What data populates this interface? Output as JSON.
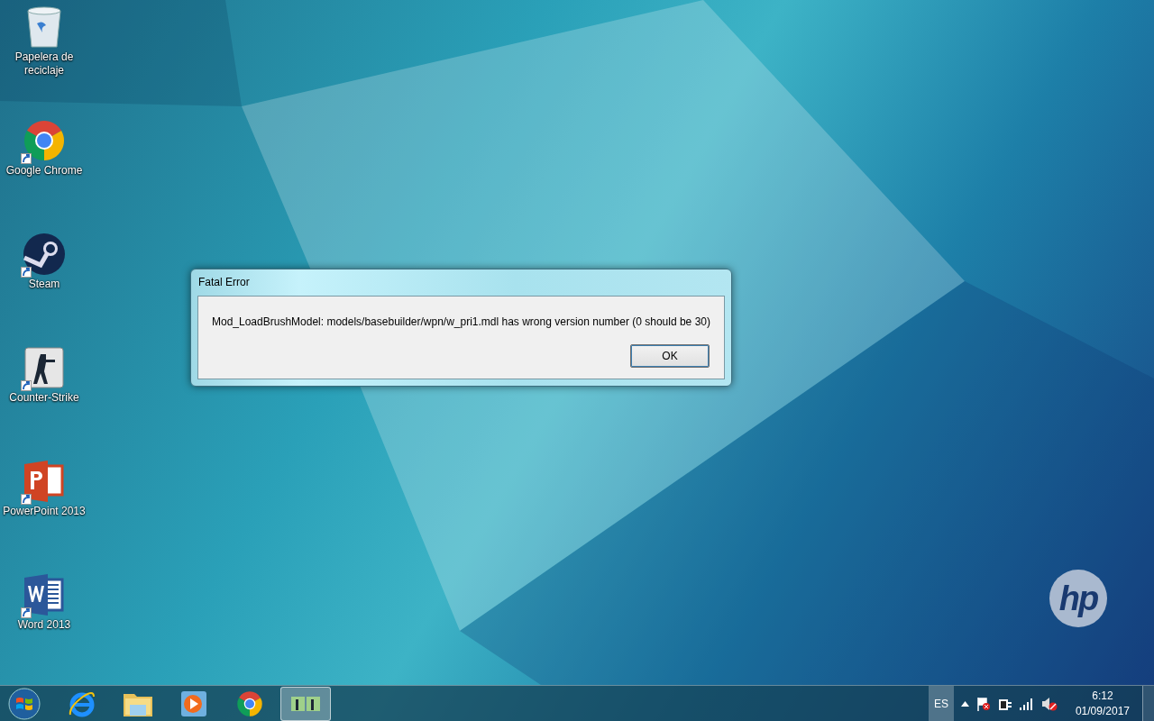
{
  "desktop_icons": [
    {
      "kind": "recycle-bin",
      "label": "Papelera de reciclaje",
      "shortcut": false
    },
    {
      "kind": "chrome",
      "label": "Google Chrome",
      "shortcut": true
    },
    {
      "kind": "steam",
      "label": "Steam",
      "shortcut": true
    },
    {
      "kind": "soldier",
      "label": "Counter-Strike",
      "shortcut": true
    },
    {
      "kind": "powerpoint",
      "label": "PowerPoint 2013",
      "shortcut": true
    },
    {
      "kind": "word",
      "label": "Word 2013",
      "shortcut": true
    }
  ],
  "dialog": {
    "title": "Fatal Error",
    "message": "Mod_LoadBrushModel: models/basebuilder/wpn/w_pri1.mdl has wrong version number (0 should be 30)",
    "buttons": [
      "OK"
    ]
  },
  "wallpaper_logo": "hp",
  "taskbar": {
    "items": [
      {
        "kind": "start",
        "active": false
      },
      {
        "kind": "ie",
        "active": false
      },
      {
        "kind": "folder",
        "active": false
      },
      {
        "kind": "media",
        "active": false
      },
      {
        "kind": "chrome",
        "active": false
      },
      {
        "kind": "soldier",
        "active": true
      }
    ],
    "language": "ES",
    "tray_icons": [
      {
        "kind": "arrow"
      },
      {
        "kind": "flag"
      },
      {
        "kind": "power"
      },
      {
        "kind": "signal"
      },
      {
        "kind": "speaker"
      }
    ],
    "time": "6:12",
    "date": "01/09/2017"
  }
}
